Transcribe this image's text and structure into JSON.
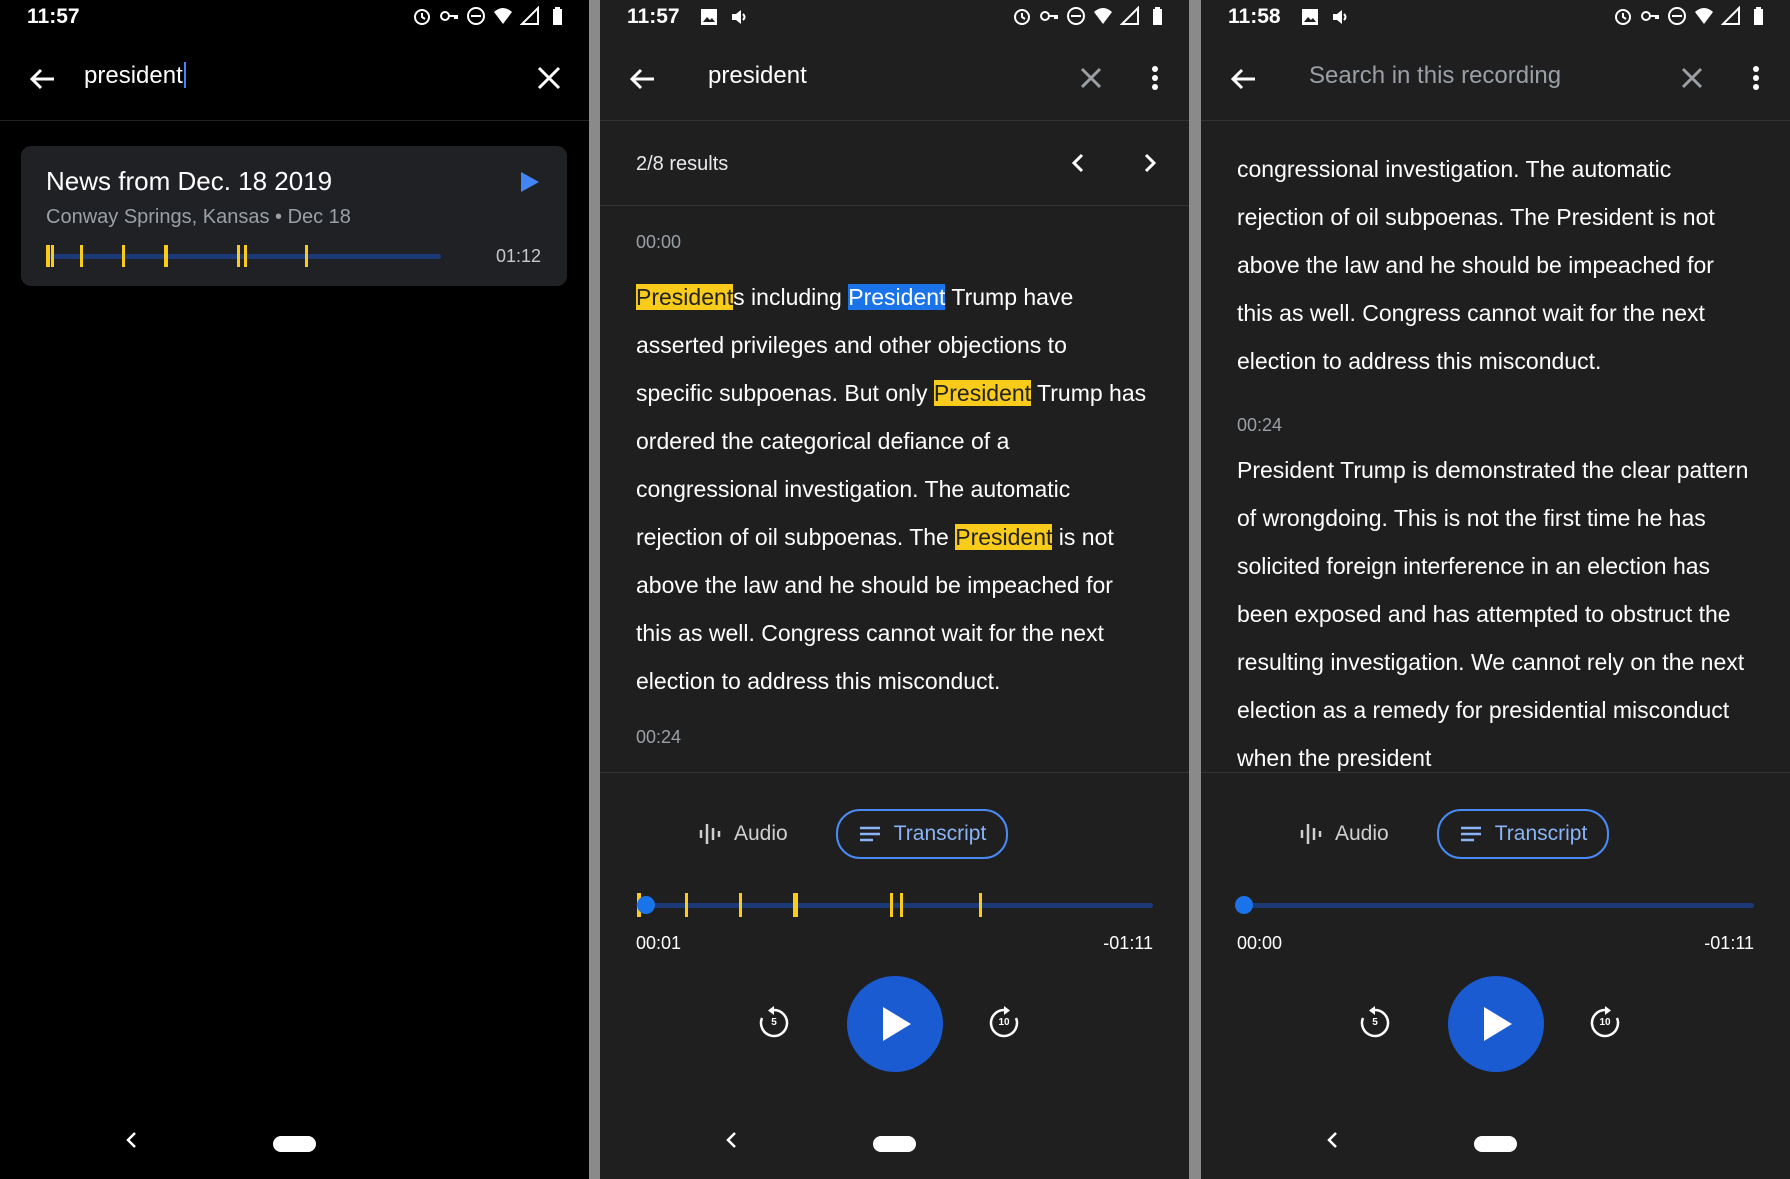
{
  "panels": [
    {
      "status_time": "11:57",
      "search_query": "president",
      "result": {
        "title": "News from Dec. 18 2019",
        "meta": "Conway Springs, Kansas • Dec 18",
        "duration": "01:12"
      },
      "icons": [
        "back-arrow-icon",
        "close-icon",
        "play-icon"
      ]
    },
    {
      "status_time": "11:57",
      "search_query": "president",
      "results_count": "2/8 results",
      "transcript": {
        "timestamp_1": "00:00",
        "paragraph_1": [
          {
            "t": "President",
            "h": "match"
          },
          {
            "t": "s including ",
            "h": ""
          },
          {
            "t": "President",
            "h": "current"
          },
          {
            "t": " Trump have asserted privileges and other objections to specific subpoenas. But only ",
            "h": ""
          },
          {
            "t": "President",
            "h": "match"
          },
          {
            "t": " Trump has ordered the categorical defiance of a congressional investigation. The automatic rejection of oil subpoenas. The ",
            "h": ""
          },
          {
            "t": "President",
            "h": "match"
          },
          {
            "t": " is not above the law and he should be impeached for this as well. Congress cannot wait for the next election to address this misconduct.",
            "h": ""
          }
        ],
        "timestamp_2": "00:24"
      },
      "tabs": {
        "audio": "Audio",
        "transcript": "Transcript"
      },
      "player": {
        "current": "00:01",
        "remaining": "-01:11",
        "rewind": "5",
        "forward": "10"
      }
    },
    {
      "status_time": "11:58",
      "search_placeholder": "Search in this recording",
      "transcript": {
        "paragraph_0": "congressional investigation. The automatic rejection of oil subpoenas. The President is not above the law and he should be impeached for this as well. Congress cannot wait for the next election to address this misconduct.",
        "timestamp_2": "00:24",
        "paragraph_2": "President Trump is demonstrated the clear pattern of wrongdoing. This is not the first time he has solicited foreign interference in an election has been exposed and has attempted to obstruct the resulting investigation. We cannot rely on the next election as a remedy for presidential misconduct when the president"
      },
      "tabs": {
        "audio": "Audio",
        "transcript": "Transcript"
      },
      "player": {
        "current": "00:00",
        "remaining": "-01:11",
        "rewind": "5",
        "forward": "10"
      }
    }
  ],
  "colors": {
    "match_highlight": "#f9cb1b",
    "current_highlight": "#1a73e8",
    "accent": "#8ab4f8",
    "background_dark": "#1f1f1f"
  }
}
